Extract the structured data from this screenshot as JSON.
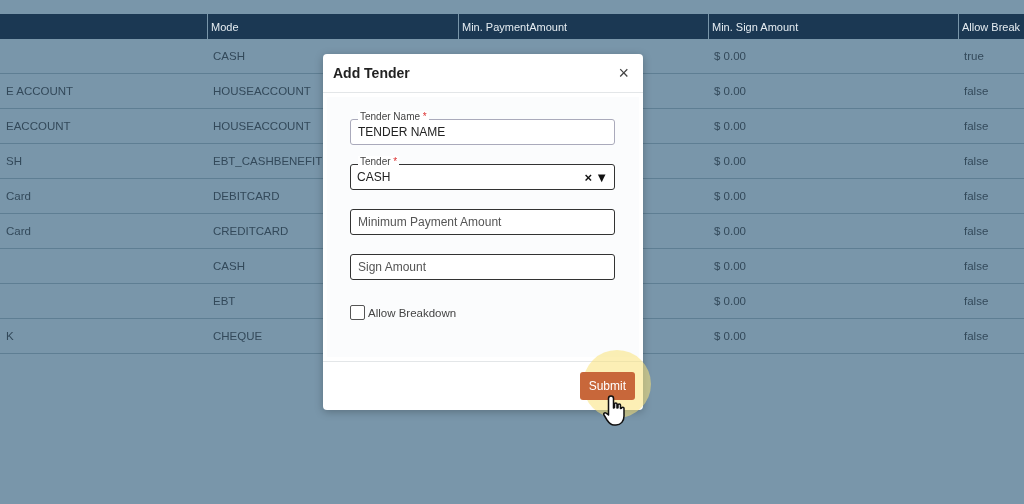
{
  "table": {
    "columns": [
      "Mode",
      "Min. PaymentAmount",
      "Min. Sign Amount",
      "Allow Break"
    ],
    "rows": [
      {
        "mode": "CASH",
        "min_sign_amount": "$ 0.00",
        "allow_breakdown": "true"
      },
      {
        "column_1": "E ACCOUNT",
        "mode": "HOUSEACCOUNT",
        "min_sign_amount": "$ 0.00",
        "allow_breakdown": "false"
      },
      {
        "column_1": "EACCOUNT",
        "mode": "HOUSEACCOUNT",
        "min_sign_amount": "$ 0.00",
        "allow_breakdown": "false"
      },
      {
        "column_1": "SH",
        "mode": "EBT_CASHBENEFIT",
        "min_sign_amount": "$ 0.00",
        "allow_breakdown": "false"
      },
      {
        "column_1": "Card",
        "mode": "DEBITCARD",
        "min_sign_amount": "$ 0.00",
        "allow_breakdown": "false"
      },
      {
        "column_1": "Card",
        "mode": "CREDITCARD",
        "min_sign_amount": "$ 0.00",
        "allow_breakdown": "false"
      },
      {
        "mode": "CASH",
        "min_sign_amount": "$ 0.00",
        "allow_breakdown": "false"
      },
      {
        "mode": "EBT",
        "min_sign_amount": "$ 0.00",
        "allow_breakdown": "false"
      },
      {
        "column_1": "K",
        "mode": "CHEQUE",
        "min_sign_amount": "$ 0.00",
        "allow_breakdown": "false"
      }
    ]
  },
  "dialog": {
    "title": "Add Tender",
    "close": "×",
    "fields": [
      {
        "kind": "text",
        "label": "Tender Name",
        "required_mark": "*",
        "value": "TENDER NAME"
      },
      {
        "kind": "select",
        "label": "Tender",
        "required_mark": "*",
        "value": "CASH",
        "clear": "×",
        "caret": "▼"
      },
      {
        "kind": "text",
        "placeholder": "Minimum Payment Amount"
      },
      {
        "kind": "text",
        "placeholder": "Sign Amount"
      }
    ],
    "checkbox": {
      "label": "Allow Breakdown",
      "checked": false
    },
    "submit": "Submit"
  }
}
